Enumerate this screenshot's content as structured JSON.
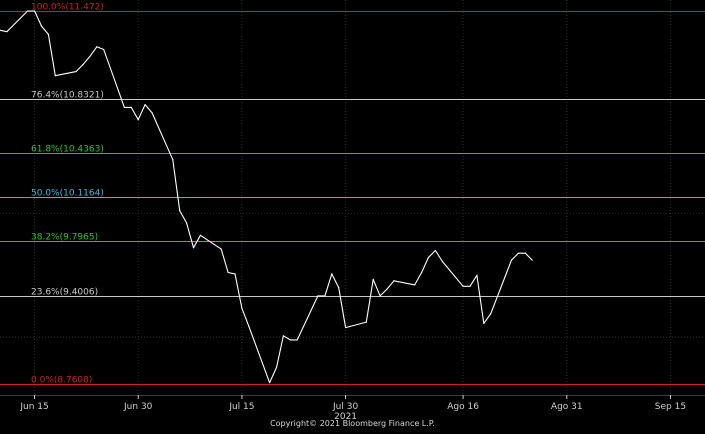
{
  "chart_data": {
    "type": "line",
    "series": [
      {
        "values": [
          [
            "2021-06-10",
            11.33
          ],
          [
            "2021-06-11",
            11.32
          ],
          [
            "2021-06-14",
            11.47
          ],
          [
            "2021-06-15",
            11.47
          ],
          [
            "2021-06-16",
            11.36
          ],
          [
            "2021-06-17",
            11.3
          ],
          [
            "2021-06-18",
            11.0
          ],
          [
            "2021-06-21",
            11.03
          ],
          [
            "2021-06-22",
            11.08
          ],
          [
            "2021-06-23",
            11.14
          ],
          [
            "2021-06-24",
            11.21
          ],
          [
            "2021-06-25",
            11.19
          ],
          [
            "2021-06-28",
            10.77
          ],
          [
            "2021-06-29",
            10.77
          ],
          [
            "2021-06-30",
            10.68
          ],
          [
            "2021-07-01",
            10.79
          ],
          [
            "2021-07-02",
            10.73
          ],
          [
            "2021-07-05",
            10.39
          ],
          [
            "2021-07-06",
            10.02
          ],
          [
            "2021-07-07",
            9.93
          ],
          [
            "2021-07-08",
            9.75
          ],
          [
            "2021-07-09",
            9.84
          ],
          [
            "2021-07-12",
            9.74
          ],
          [
            "2021-07-13",
            9.57
          ],
          [
            "2021-07-14",
            9.56
          ],
          [
            "2021-07-15",
            9.31
          ],
          [
            "2021-07-16",
            9.18
          ],
          [
            "2021-07-19",
            8.77
          ],
          [
            "2021-07-20",
            8.88
          ],
          [
            "2021-07-21",
            9.11
          ],
          [
            "2021-07-22",
            9.08
          ],
          [
            "2021-07-23",
            9.08
          ],
          [
            "2021-07-26",
            9.4
          ],
          [
            "2021-07-27",
            9.4
          ],
          [
            "2021-07-28",
            9.56
          ],
          [
            "2021-07-29",
            9.46
          ],
          [
            "2021-07-30",
            9.17
          ],
          [
            "2021-08-02",
            9.21
          ],
          [
            "2021-08-03",
            9.52
          ],
          [
            "2021-08-04",
            9.4
          ],
          [
            "2021-08-05",
            9.45
          ],
          [
            "2021-08-06",
            9.51
          ],
          [
            "2021-08-09",
            9.48
          ],
          [
            "2021-08-10",
            9.57
          ],
          [
            "2021-08-11",
            9.68
          ],
          [
            "2021-08-12",
            9.73
          ],
          [
            "2021-08-13",
            9.65
          ],
          [
            "2021-08-16",
            9.47
          ],
          [
            "2021-08-17",
            9.47
          ],
          [
            "2021-08-18",
            9.55
          ],
          [
            "2021-08-19",
            9.2
          ],
          [
            "2021-08-20",
            9.27
          ],
          [
            "2021-08-23",
            9.66
          ],
          [
            "2021-08-24",
            9.71
          ],
          [
            "2021-08-25",
            9.71
          ],
          [
            "2021-08-26",
            9.66
          ]
        ],
        "color": "#ffffff"
      }
    ],
    "x_axis": {
      "ticks": [
        "Jun 15",
        "Jun 30",
        "Jul 15",
        "Jul 30",
        "Ago 16",
        "Ago 31",
        "Sep 15"
      ],
      "tick_dates": [
        "2021-06-15",
        "2021-06-30",
        "2021-07-15",
        "2021-07-30",
        "2021-08-16",
        "2021-08-31",
        "2021-09-15"
      ],
      "year_label": "2021",
      "range": [
        "2021-06-10",
        "2021-09-20"
      ]
    },
    "y_axis": {
      "range": [
        8.68,
        11.55
      ]
    },
    "fibonacci_levels": [
      {
        "label": "100.0%(11.472)",
        "value": 11.472,
        "color": "#d02020"
      },
      {
        "label": "76.4%(10.8321)",
        "value": 10.8321,
        "color": "#c8c8c8"
      },
      {
        "label": "61.8%(10.4363)",
        "value": 10.4363,
        "color": "#28c828"
      },
      {
        "label": "50.0%(10.1164)",
        "value": 10.1164,
        "color": "#3fb8e0"
      },
      {
        "label": "38.2%(9.7965)",
        "value": 9.7965,
        "color": "#28c828"
      },
      {
        "label": "23.6%(9.4006)",
        "value": 9.4006,
        "color": "#c8c8c8"
      },
      {
        "label": "0.0%(8.7608)",
        "value": 8.7608,
        "color": "#d02020"
      }
    ],
    "grid": true,
    "background": "#000000",
    "grid_color": "#2c2c2c",
    "tick_color": "#d0d0d0"
  },
  "footer": {
    "copyright": "Copyright© 2021 Bloomberg Finance L.P."
  }
}
